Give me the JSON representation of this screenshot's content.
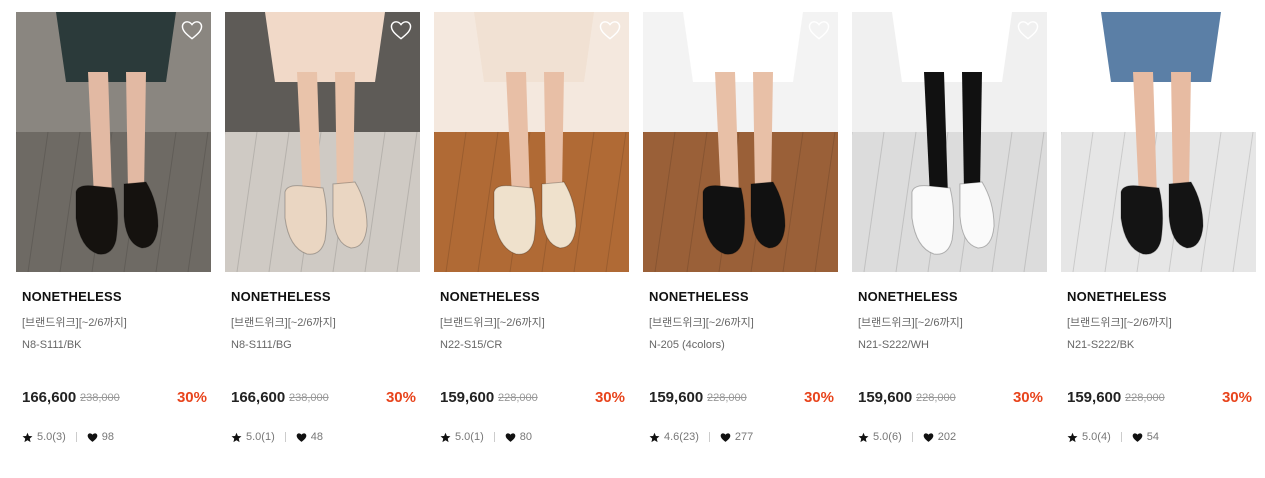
{
  "products": [
    {
      "brand": "NONETHELESS",
      "promo": "[브랜드위크][~2/6까지]",
      "code": "N8-S111/BK",
      "price": "166,600",
      "original_price": "238,000",
      "discount": "30%",
      "rating": "5.0(3)",
      "likes": "98",
      "image": {
        "bg": "#8a8680",
        "floor": "#6e6a64",
        "leg": "#e2b9a3",
        "shoe": "#15120f",
        "garment": "#2b3a3a",
        "style": "strap-black"
      }
    },
    {
      "brand": "NONETHELESS",
      "promo": "[브랜드위크][~2/6까지]",
      "code": "N8-S111/BG",
      "price": "166,600",
      "original_price": "238,000",
      "discount": "30%",
      "rating": "5.0(1)",
      "likes": "48",
      "image": {
        "bg": "#5e5b57",
        "floor": "#cfcac4",
        "leg": "#e9c3aa",
        "shoe": "#ead6c2",
        "garment": "#f1d9c8",
        "style": "strap-beige"
      }
    },
    {
      "brand": "NONETHELESS",
      "promo": "[브랜드위크][~2/6까지]",
      "code": "N22-S15/CR",
      "price": "159,600",
      "original_price": "228,000",
      "discount": "30%",
      "rating": "5.0(1)",
      "likes": "80",
      "image": {
        "bg": "#f4e8de",
        "floor": "#b06a35",
        "leg": "#e8bfa6",
        "shoe": "#efe1cc",
        "garment": "#f1e1d3",
        "style": "maryjane-cream"
      }
    },
    {
      "brand": "NONETHELESS",
      "promo": "[브랜드위크][~2/6까지]",
      "code": "N-205 (4colors)",
      "price": "159,600",
      "original_price": "228,000",
      "discount": "30%",
      "rating": "4.6(23)",
      "likes": "277",
      "image": {
        "bg": "#f3f3f3",
        "floor": "#9a6038",
        "leg": "#e8c0a7",
        "shoe": "#111111",
        "garment": "#ffffff",
        "style": "tbar-black"
      }
    },
    {
      "brand": "NONETHELESS",
      "promo": "[브랜드위크][~2/6까지]",
      "code": "N21-S222/WH",
      "price": "159,600",
      "original_price": "228,000",
      "discount": "30%",
      "rating": "5.0(6)",
      "likes": "202",
      "image": {
        "bg": "#f0f0f0",
        "floor": "#dcdcdc",
        "leg": "#111111",
        "shoe": "#fafafa",
        "garment": "#ffffff",
        "style": "slingback-white"
      }
    },
    {
      "brand": "NONETHELESS",
      "promo": "[브랜드위크][~2/6까지]",
      "code": "N21-S222/BK",
      "price": "159,600",
      "original_price": "228,000",
      "discount": "30%",
      "rating": "5.0(4)",
      "likes": "54",
      "image": {
        "bg": "#ffffff",
        "floor": "#e6e6e6",
        "leg": "#e7bba2",
        "shoe": "#141414",
        "garment": "#5b7fa6",
        "style": "slingback-black"
      }
    }
  ],
  "icons": {
    "wishlist": "heart-outline-icon",
    "rating": "star-icon",
    "likes": "heart-filled-icon"
  },
  "colors": {
    "discount": "#e8441c",
    "text": "#222222",
    "muted": "#777777"
  }
}
